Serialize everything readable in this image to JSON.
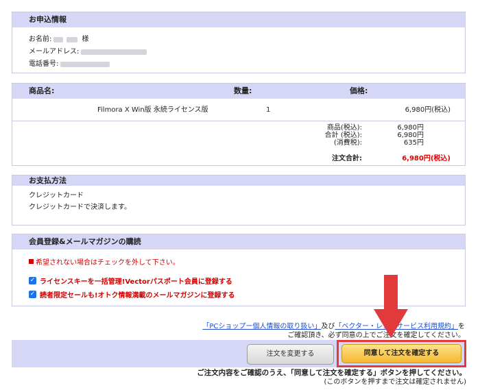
{
  "applicant": {
    "title": "お申込情報",
    "name_label": "お名前:",
    "name_suffix": "様",
    "email_label": "メールアドレス:",
    "phone_label": "電話番号:"
  },
  "products": {
    "col_name": "商品名:",
    "col_qty": "数量:",
    "col_price": "価格:",
    "item": {
      "name": "Filmora X Win版 永続ライセンス版",
      "qty": "1",
      "price": "6,980円(税込)"
    },
    "summary": {
      "subtotal_label": "商品(税込):",
      "subtotal_value": "6,980円",
      "sum_label": "合計 (税込):",
      "sum_value": "6,980円",
      "tax_label": "(消費税):",
      "tax_value": "635円",
      "total_label": "注文合計:",
      "total_value": "6,980円(税込)"
    }
  },
  "payment": {
    "title": "お支払方法",
    "method": "クレジットカード",
    "detail": "クレジットカードで決済します。"
  },
  "member": {
    "title": "会員登録&メールマガジンの購読",
    "warning": "希望されない場合はチェックを外して下さい。",
    "option1": "ライセンスキーを一括管理!Vectorパスポート会員に登録する",
    "option2": "読者限定セールも!オトク情報満載のメールマガジンに登録する"
  },
  "notice": {
    "link1": "「PCショップー個人情報の取り扱い」",
    "and": "及び",
    "link2": "「ベクター・レジ・サービス利用規約」",
    "tail": "を",
    "line2": "ご確認頂き、必ず同意の上でご注文を確定してください。"
  },
  "buttons": {
    "change": "注文を変更する",
    "confirm": "同意して注文を確定する"
  },
  "footer": {
    "line1": "ご注文内容をご確認のうえ、「同意して注文を確定する」ボタンを押してください。",
    "line2": "(このボタンを押すまで注文は確定されません)"
  },
  "colors": {
    "accent_header": "#d6d6f6",
    "warning_red": "#e00000",
    "confirm_button": "#f4b830",
    "highlight_arrow": "#e23a3a"
  }
}
